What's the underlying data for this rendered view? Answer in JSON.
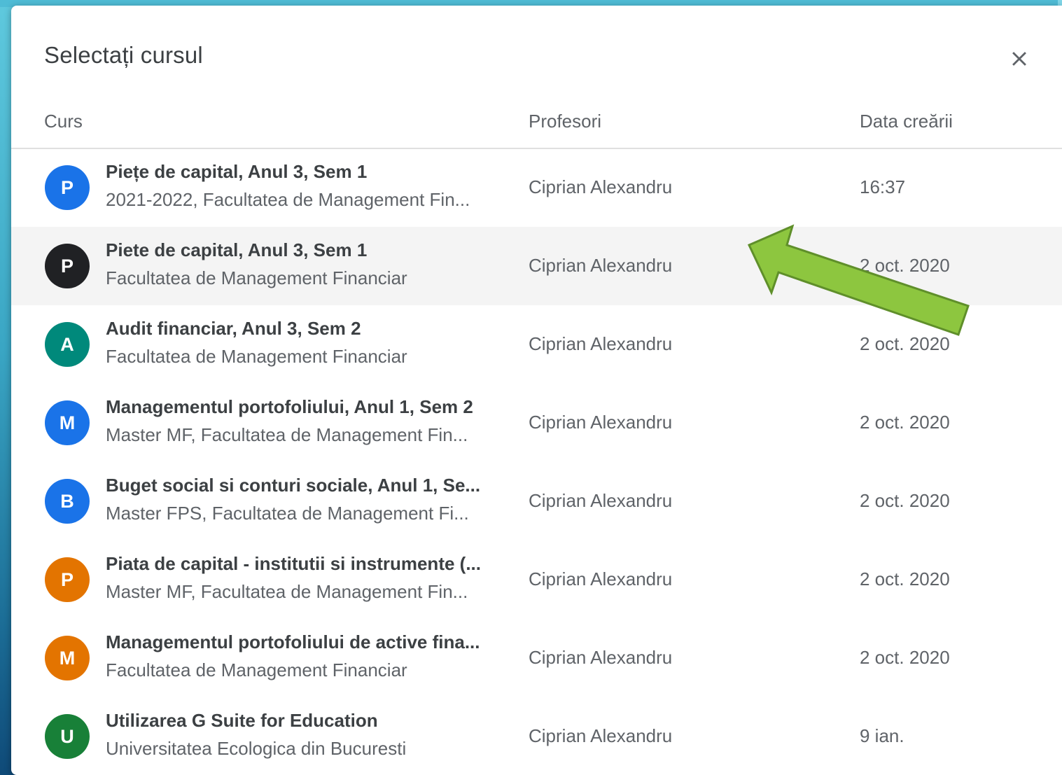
{
  "colors": {
    "arrow_fill": "#8dc63f",
    "arrow_stroke": "#5f8f2a",
    "highlight_row": "#f4f4f4"
  },
  "dialog": {
    "title": "Selectați cursul",
    "close_icon": "close-icon"
  },
  "table": {
    "headers": {
      "course": "Curs",
      "teachers": "Profesori",
      "created": "Data creării"
    },
    "rows": [
      {
        "avatar_letter": "P",
        "avatar_color": "#1a73e8",
        "name": "Piețe de capital, Anul 3, Sem 1",
        "section": "2021-2022, Facultatea de Management Fin...",
        "teacher": "Ciprian Alexandru",
        "created": "16:37",
        "highlighted": false
      },
      {
        "avatar_letter": "P",
        "avatar_color": "#202124",
        "name": "Piete de capital, Anul 3, Sem 1",
        "section": "Facultatea de Management Financiar",
        "teacher": "Ciprian Alexandru",
        "created": "2 oct. 2020",
        "highlighted": true
      },
      {
        "avatar_letter": "A",
        "avatar_color": "#00897b",
        "name": "Audit financiar, Anul 3, Sem 2",
        "section": "Facultatea de Management Financiar",
        "teacher": "Ciprian Alexandru",
        "created": "2 oct. 2020",
        "highlighted": false
      },
      {
        "avatar_letter": "M",
        "avatar_color": "#1a73e8",
        "name": "Managementul portofoliului, Anul 1, Sem 2",
        "section": "Master MF, Facultatea de Management Fin...",
        "teacher": "Ciprian Alexandru",
        "created": "2 oct. 2020",
        "highlighted": false
      },
      {
        "avatar_letter": "B",
        "avatar_color": "#1a73e8",
        "name": "Buget social si conturi sociale, Anul 1, Se...",
        "section": "Master FPS, Facultatea de Management Fi...",
        "teacher": "Ciprian Alexandru",
        "created": "2 oct. 2020",
        "highlighted": false
      },
      {
        "avatar_letter": "P",
        "avatar_color": "#e37400",
        "name": "Piata de capital - institutii si instrumente (...",
        "section": "Master MF, Facultatea de Management Fin...",
        "teacher": "Ciprian Alexandru",
        "created": "2 oct. 2020",
        "highlighted": false
      },
      {
        "avatar_letter": "M",
        "avatar_color": "#e37400",
        "name": "Managementul portofoliului de active fina...",
        "section": "Facultatea de Management Financiar",
        "teacher": "Ciprian Alexandru",
        "created": "2 oct. 2020",
        "highlighted": false
      },
      {
        "avatar_letter": "U",
        "avatar_color": "#188038",
        "name": "Utilizarea G Suite for Education",
        "section": "Universitatea Ecologica din Bucuresti",
        "teacher": "Ciprian Alexandru",
        "created": "9 ian.",
        "highlighted": false
      }
    ]
  },
  "annotation": {
    "arrow_icon": "arrow-pointer-icon"
  }
}
